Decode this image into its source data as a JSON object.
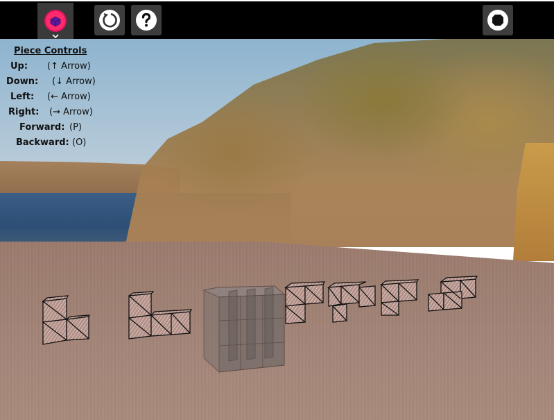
{
  "toolbar": {
    "piece_icon": "pink-cube-icon",
    "reset_icon": "reset-icon",
    "help_icon": "question-icon",
    "stop_icon": "stop-icon",
    "accent": "#e0115f"
  },
  "controls": {
    "title": "Piece Controls",
    "rows": [
      {
        "key": "Up:",
        "value": "(↑ Arrow)"
      },
      {
        "key": "Down:",
        "value": "(↓ Arrow)"
      },
      {
        "key": "Left:",
        "value": "(← Arrow)"
      },
      {
        "key": "Right:",
        "value": "(→ Arrow)"
      },
      {
        "key": "Forward:",
        "value": "(P)"
      },
      {
        "key": "Backward:",
        "value": "(O)"
      }
    ]
  },
  "scene": {
    "pieces": [
      "l-piece",
      "long-l-piece",
      "target-cube",
      "square-piece",
      "t-piece",
      "step-piece",
      "corner-piece"
    ]
  }
}
